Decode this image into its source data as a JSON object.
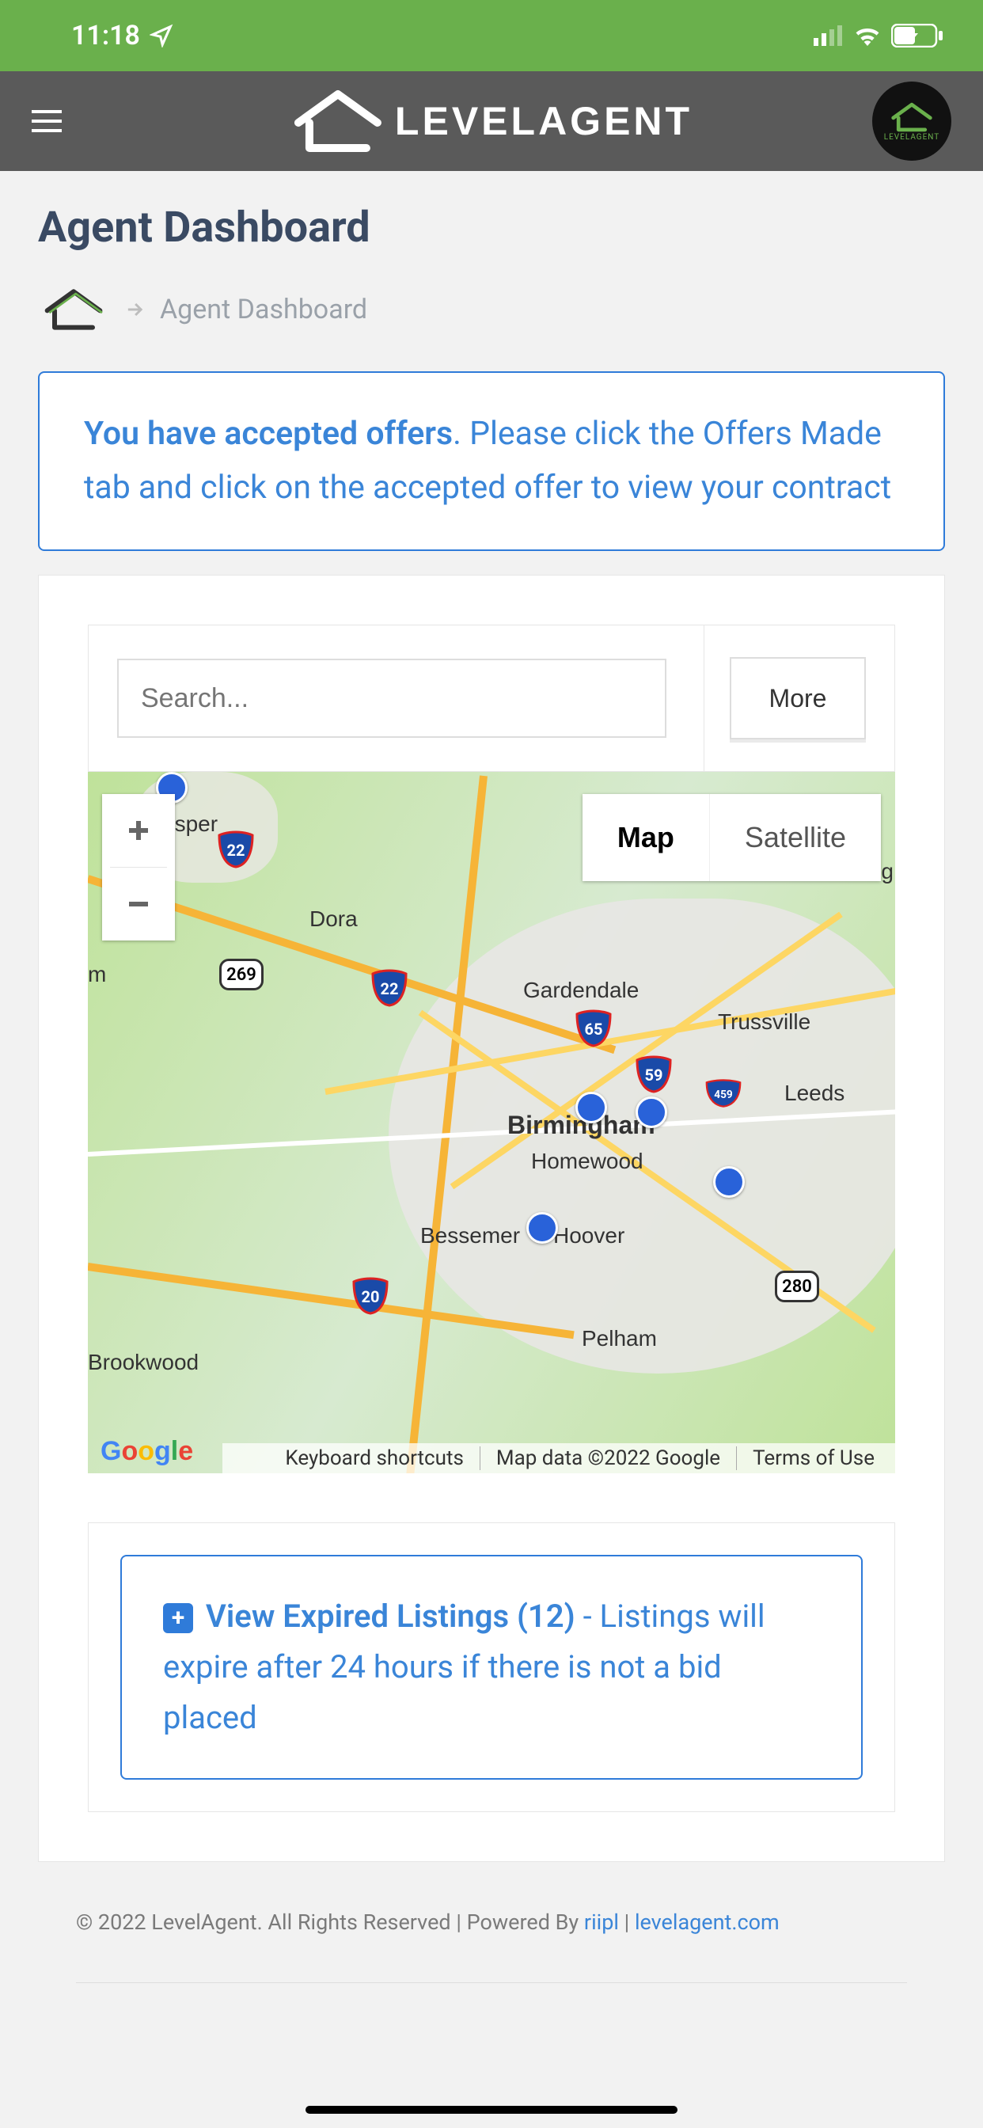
{
  "status_bar": {
    "time": "11:18"
  },
  "header": {
    "brand": "LEVELAGENT"
  },
  "page": {
    "title": "Agent Dashboard"
  },
  "breadcrumb": {
    "current": "Agent Dashboard"
  },
  "alert": {
    "bold": "You have accepted offers",
    "rest": ". Please click the Offers Made tab and click on the accepted offer to view your contract"
  },
  "search": {
    "placeholder": "Search...",
    "more_label": "More"
  },
  "map": {
    "type_map": "Map",
    "type_satellite": "Satellite",
    "labels": {
      "jasper": "Jasper",
      "dora": "Dora",
      "gardendale": "Gardendale",
      "trussville": "Trussville",
      "leeds": "Leeds",
      "birmingham": "Birmingham",
      "homewood": "Homewood",
      "hoover": "Hoover",
      "bessemer": "Bessemer",
      "pelham": "Pelham",
      "brookwood": "Brookwood",
      "ng": "ng",
      "m": "m"
    },
    "shields": {
      "i22a": "22",
      "i22b": "22",
      "i65": "65",
      "i59": "59",
      "i459": "459",
      "i20": "20",
      "us269": "269",
      "us280": "280"
    },
    "attribution": {
      "shortcuts": "Keyboard shortcuts",
      "data": "Map data ©2022 Google",
      "terms": "Terms of Use"
    }
  },
  "expired": {
    "title": "View Expired Listings (12) ",
    "dash": "- ",
    "body": "Listings will expire after 24 hours if there is not a bid placed"
  },
  "footer": {
    "copyright": "© 2022 LevelAgent. All Rights Reserved | Powered By ",
    "link1": "riipl",
    "sep": " | ",
    "link2": "levelagent.com"
  }
}
